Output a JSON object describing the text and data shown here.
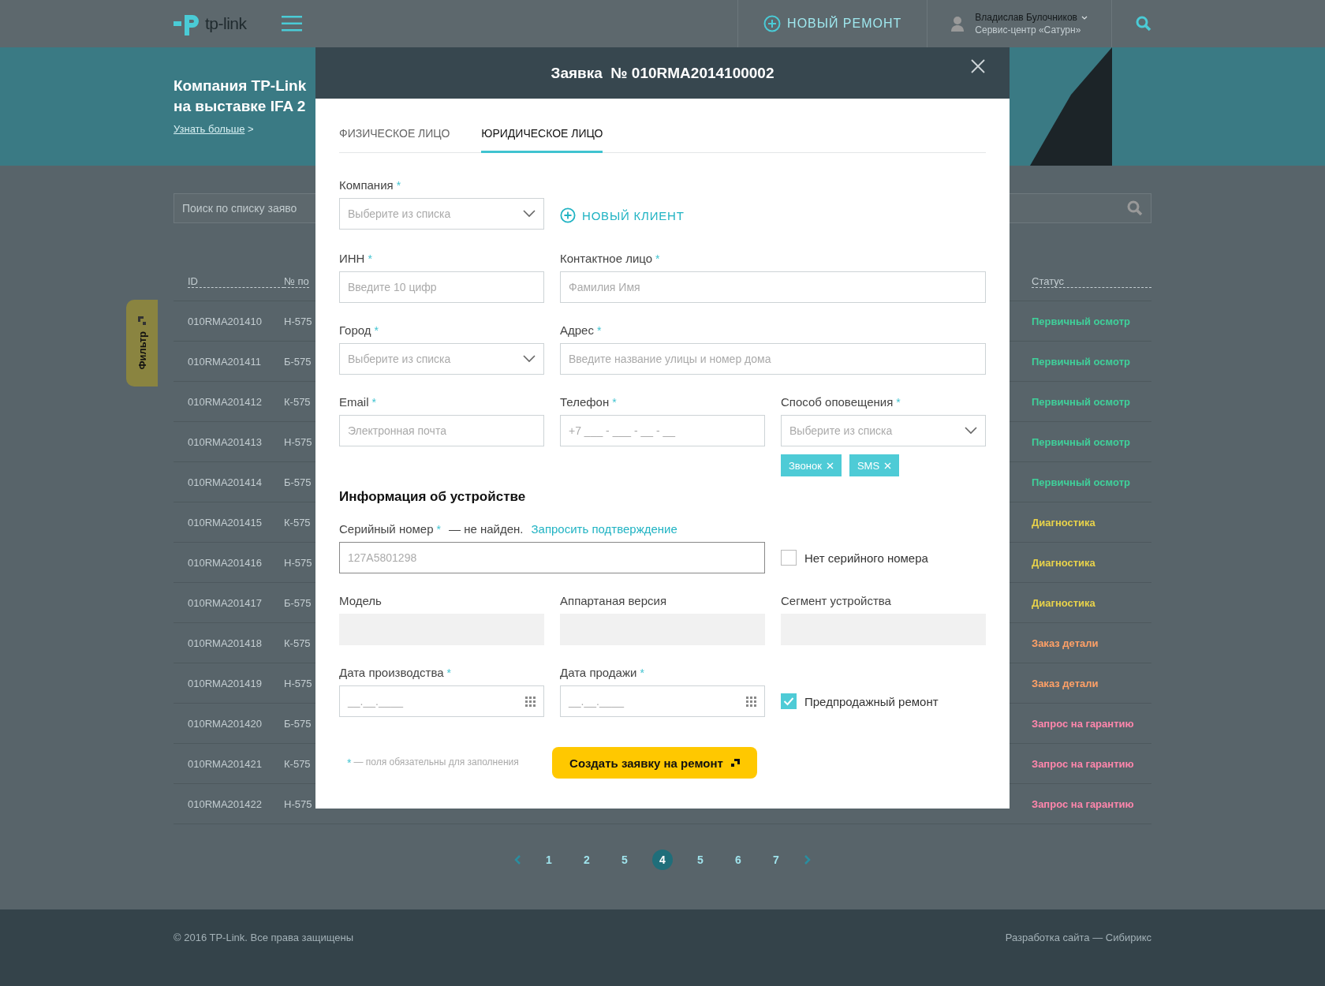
{
  "header": {
    "logo_text": "tp-link",
    "new_repair": "НОВЫЙ РЕМОНТ",
    "user_name": "Владислав Булочников",
    "user_org": "Сервис-центр «Сатурн»"
  },
  "banner": {
    "title_lines": [
      "Компания TP-Link",
      "на выставке IFA 2"
    ],
    "link": "Узнать больше",
    "link_arrow": ">"
  },
  "search": {
    "placeholder": "Поиск по списку заяво"
  },
  "filter_tab": {
    "label": "Фильтр"
  },
  "table": {
    "columns": [
      "ID",
      "№ по",
      "Статус"
    ],
    "rows": [
      {
        "id": "010RMA201410",
        "number": "Н-575",
        "status": "Первичный осмотр",
        "color": "#3fd09a"
      },
      {
        "id": "010RMA201411",
        "number": "Б-575",
        "status": "Первичный осмотр",
        "color": "#3fd09a"
      },
      {
        "id": "010RMA201412",
        "number": "К-575",
        "status": "Первичный осмотр",
        "color": "#3fd09a"
      },
      {
        "id": "010RMA201413",
        "number": "Н-575",
        "status": "Первичный осмотр",
        "color": "#3fd09a"
      },
      {
        "id": "010RMA201414",
        "number": "Б-575",
        "status": "Первичный осмотр",
        "color": "#3fd09a"
      },
      {
        "id": "010RMA201415",
        "number": "К-575",
        "status": "Диагностика",
        "color": "#e8d24a"
      },
      {
        "id": "010RMA201416",
        "number": "Н-575",
        "status": "Диагностика",
        "color": "#e8d24a"
      },
      {
        "id": "010RMA201417",
        "number": "Б-575",
        "status": "Диагностика",
        "color": "#e8d24a"
      },
      {
        "id": "010RMA201418",
        "number": "К-575",
        "status": "Заказ детали",
        "color": "#ffa066"
      },
      {
        "id": "010RMA201419",
        "number": "Н-575",
        "status": "Заказ детали",
        "color": "#ffa066"
      },
      {
        "id": "010RMA201420",
        "number": "Б-575",
        "status": "Запрос на гарантию",
        "color": "#ff86ac"
      },
      {
        "id": "010RMA201421",
        "number": "К-575",
        "status": "Запрос на гарантию",
        "color": "#ff86ac"
      },
      {
        "id": "010RMA201422",
        "number": "Н-575",
        "status": "Запрос на гарантию",
        "color": "#ff86ac"
      }
    ]
  },
  "pagination": {
    "pages": [
      {
        "label": "1",
        "selected": false
      },
      {
        "label": "2",
        "selected": false
      },
      {
        "label": "5",
        "selected": false
      },
      {
        "label": "4",
        "selected": true
      },
      {
        "label": "5",
        "selected": false
      },
      {
        "label": "6",
        "selected": false
      },
      {
        "label": "7",
        "selected": false
      }
    ]
  },
  "footer": {
    "copyright": "© 2016 TP-Link. Все права защищены",
    "credit": "Разработка сайта — Сибирикс"
  },
  "modal": {
    "title": "Заявка  № 010RMA2014100002",
    "required_mark": "*",
    "tabs": [
      {
        "label": "ФИЗИЧЕСКОЕ ЛИЦО",
        "selected": false
      },
      {
        "label": "ЮРИДИЧЕСКОЕ ЛИЦО",
        "selected": true
      }
    ],
    "company": {
      "label": "Компания",
      "required": true,
      "placeholder": "Выберите из списка"
    },
    "new_client": "НОВЫЙ КЛИЕНТ",
    "inn": {
      "label": "ИНН",
      "required": true,
      "placeholder": "Введите 10 цифр"
    },
    "contact": {
      "label": "Контактное лицо",
      "required": true,
      "placeholder": "Фамилия Имя"
    },
    "city": {
      "label": "Город",
      "required": true,
      "placeholder": "Выберите из списка"
    },
    "address": {
      "label": "Адрес",
      "required": true,
      "placeholder": "Введите название улицы и номер дома"
    },
    "email": {
      "label": "Email",
      "required": true,
      "placeholder": "Электронная почта"
    },
    "phone": {
      "label": "Телефон",
      "required": true,
      "placeholder": "+7 ___ - ___ - __ - __"
    },
    "notify": {
      "label": "Способ оповещения",
      "required": true,
      "placeholder": "Выберите из списка",
      "tags": [
        "Звонок",
        "SMS"
      ]
    },
    "section_title": "Информация об устройстве",
    "serial": {
      "label": "Серийный номер",
      "required": true,
      "note": "— не найден.",
      "link": "Запросить подтверждение",
      "placeholder": "127A5801298"
    },
    "no_serial": {
      "label": "Нет серийного номера",
      "checked": false
    },
    "model": {
      "label": "Модель",
      "required": false
    },
    "hw_version": {
      "label": "Аппартаная версия",
      "required": false
    },
    "segment": {
      "label": "Сегмент устройства",
      "required": false
    },
    "prod_date": {
      "label": "Дата производства",
      "required": true,
      "placeholder": "__.__.____"
    },
    "sale_date": {
      "label": "Дата продажи",
      "required": true,
      "placeholder": "__.__.____"
    },
    "presale": {
      "label": "Предпродажный ремонт",
      "checked": true
    },
    "required_note": "— поля обязательны для заполнения",
    "submit": "Создать заявку на ремонт"
  }
}
